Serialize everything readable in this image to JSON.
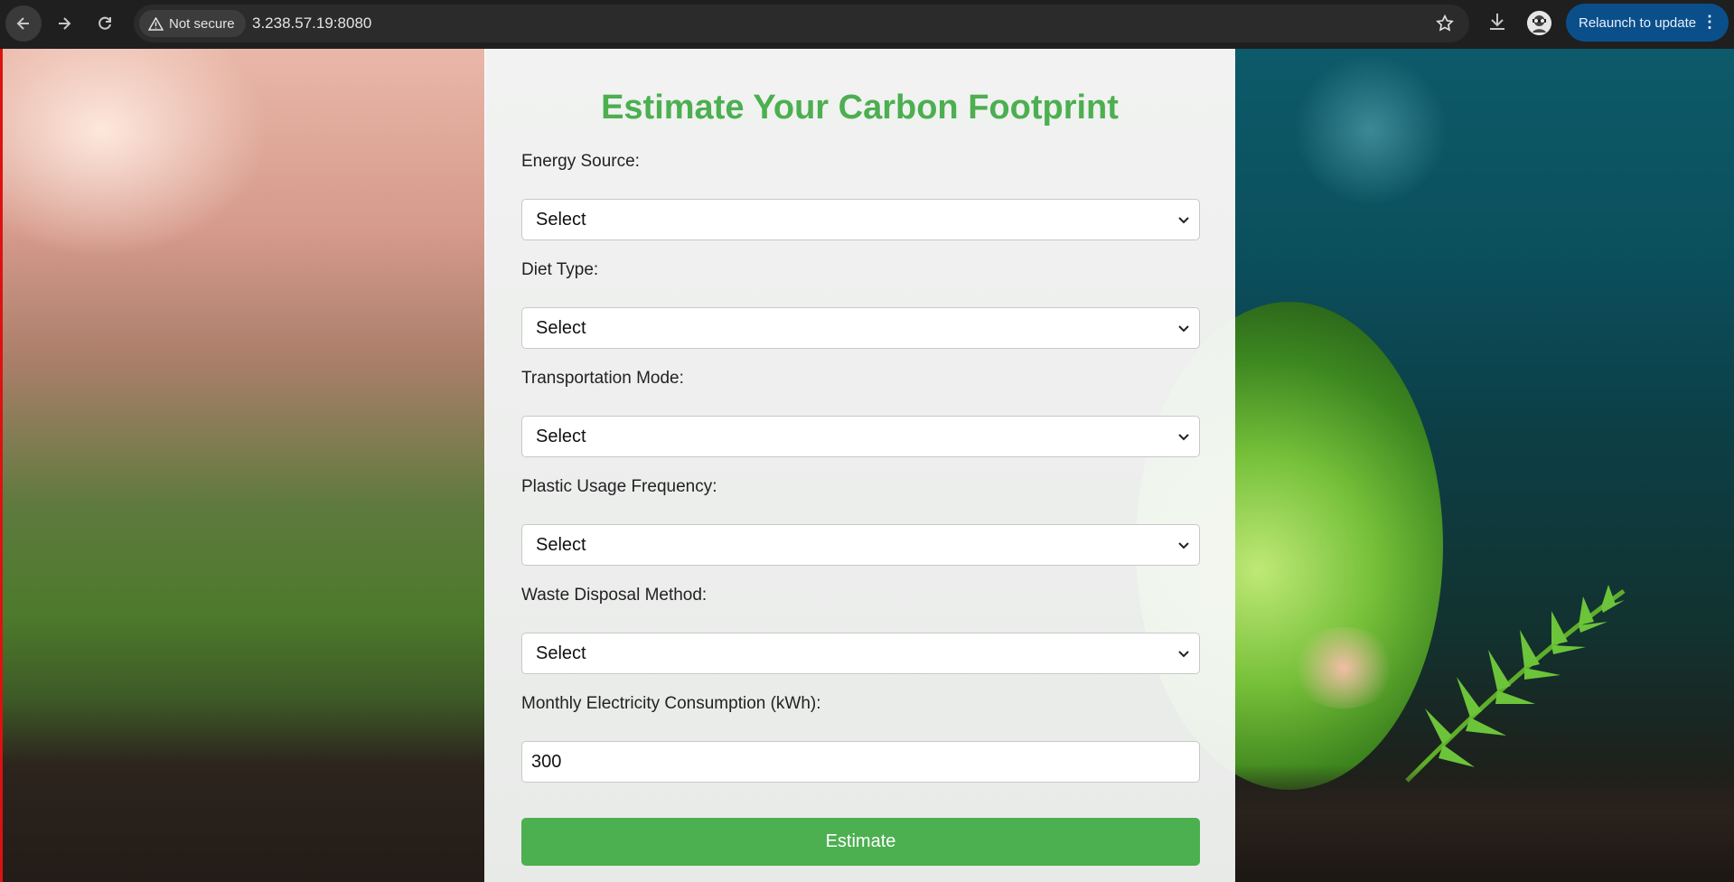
{
  "browser": {
    "security_label": "Not secure",
    "url": "3.238.57.19:8080",
    "relaunch_label": "Relaunch to update",
    "icons": [
      "back-icon",
      "forward-icon",
      "reload-icon",
      "warning-icon",
      "star-icon",
      "download-icon",
      "avatar",
      "menu-icon"
    ]
  },
  "form": {
    "title": "Estimate Your Carbon Footprint",
    "title_color": "#4caf50",
    "fields": [
      {
        "label": "Energy Source:",
        "value": "Select"
      },
      {
        "label": "Diet Type:",
        "value": "Select"
      },
      {
        "label": "Transportation Mode:",
        "value": "Select"
      },
      {
        "label": "Plastic Usage Frequency:",
        "value": "Select"
      },
      {
        "label": "Waste Disposal Method:",
        "value": "Select"
      }
    ],
    "electricity": {
      "label": "Monthly Electricity Consumption (kWh):",
      "value": "300"
    },
    "submit_label": "Estimate"
  }
}
